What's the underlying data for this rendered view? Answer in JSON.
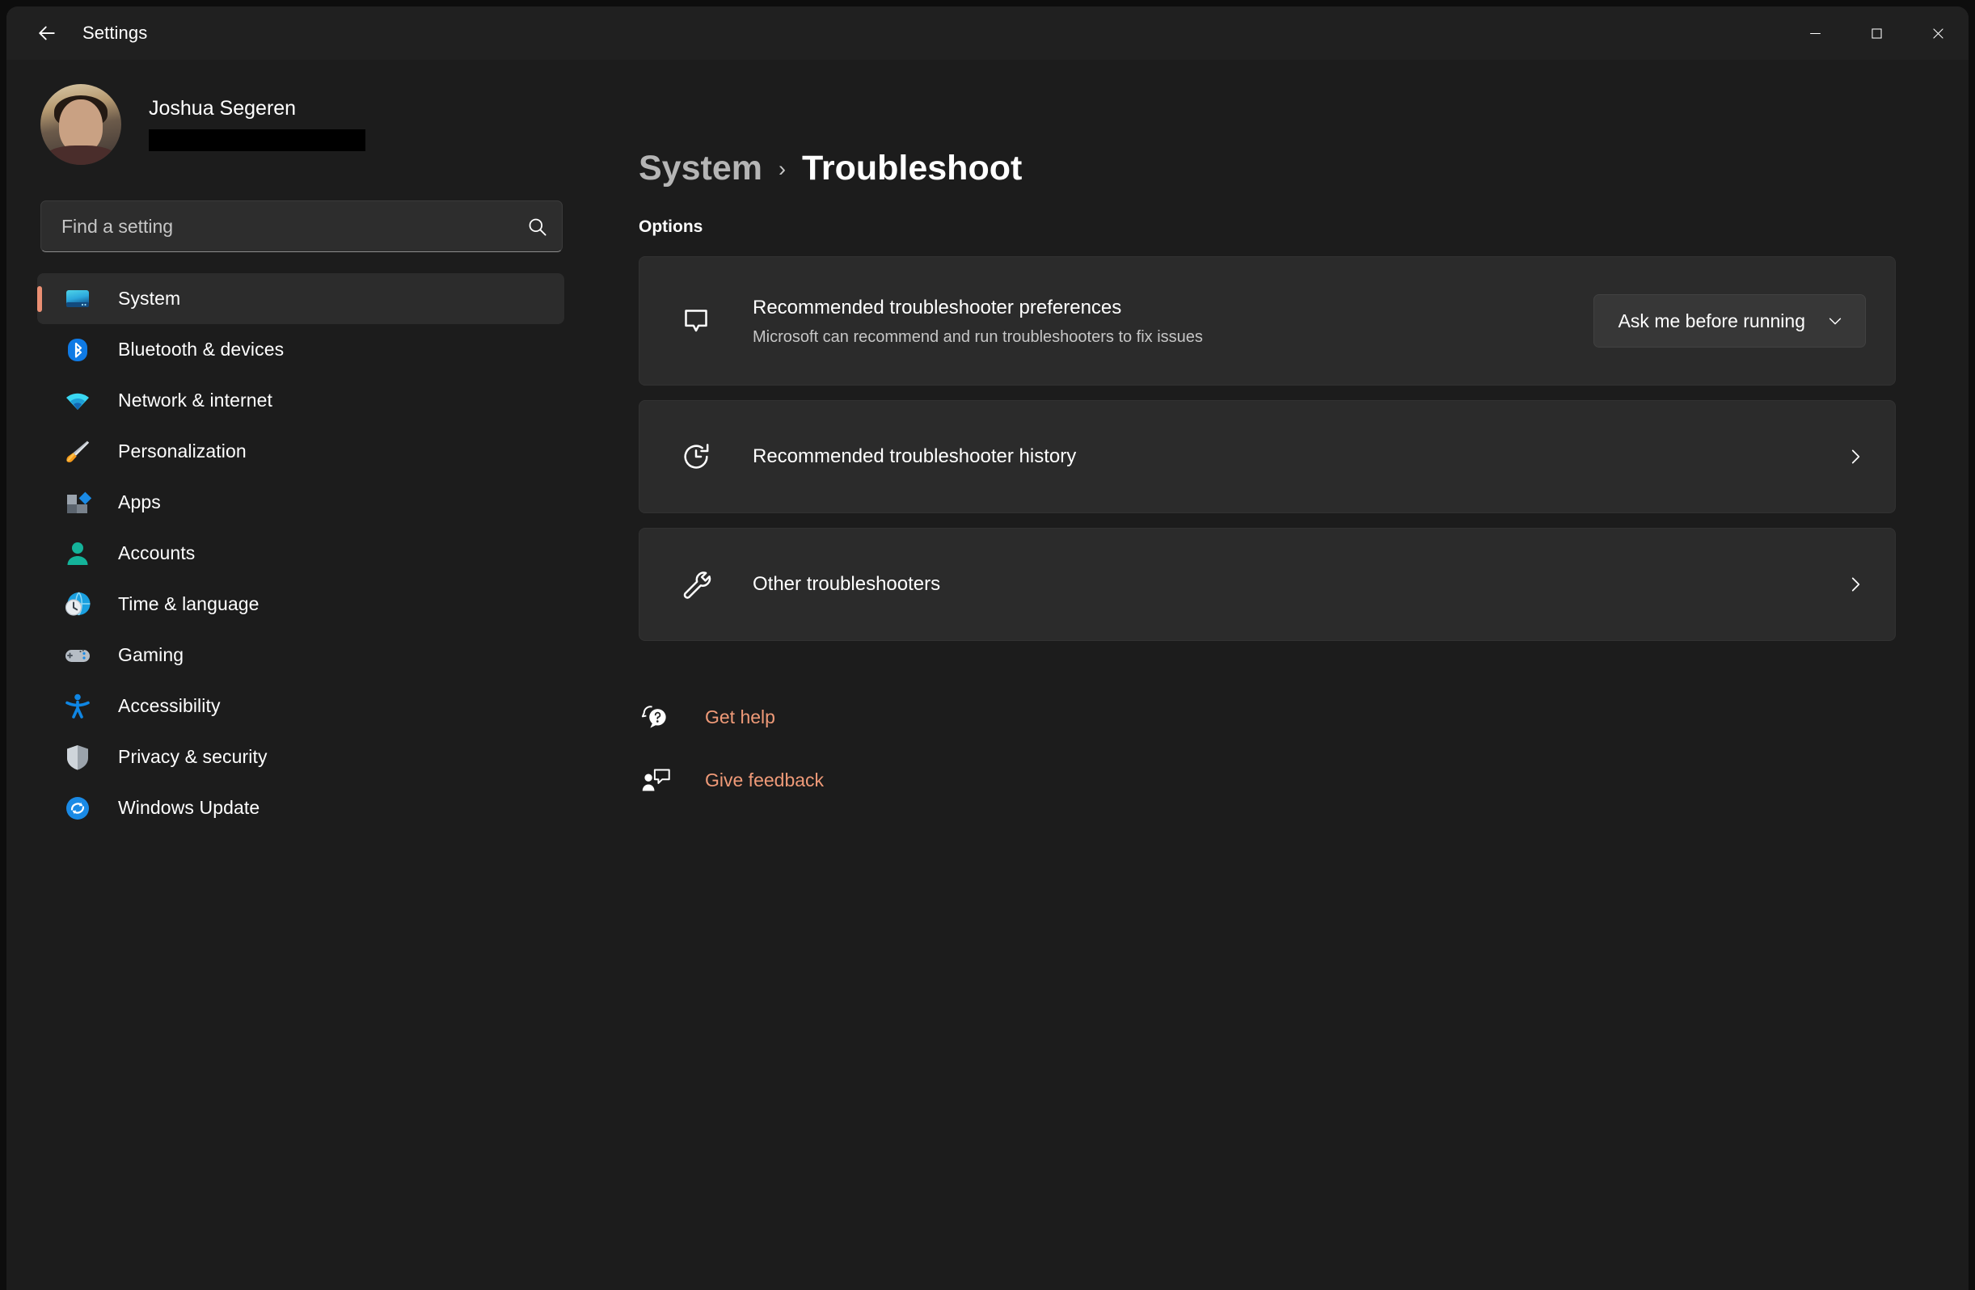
{
  "window": {
    "title": "Settings",
    "back_icon": "back-arrow-icon",
    "controls": {
      "minimize": "minimize-icon",
      "maximize": "maximize-icon",
      "close": "close-icon"
    }
  },
  "colors": {
    "accent": "#ef9a78",
    "selection_bar": "#ea8f73",
    "page_bg": "#1c1c1c",
    "card_bg": "#2b2b2b",
    "titlebar_bg": "#202020"
  },
  "sidebar": {
    "profile": {
      "name": "Joshua Segeren",
      "email_redacted": true
    },
    "search": {
      "placeholder": "Find a setting",
      "value": "",
      "icon": "search-icon"
    },
    "items": [
      {
        "label": "System",
        "icon": "monitor-icon",
        "selected": true
      },
      {
        "label": "Bluetooth & devices",
        "icon": "bluetooth-icon",
        "selected": false
      },
      {
        "label": "Network & internet",
        "icon": "wifi-icon",
        "selected": false
      },
      {
        "label": "Personalization",
        "icon": "paintbrush-icon",
        "selected": false
      },
      {
        "label": "Apps",
        "icon": "apps-blocks-icon",
        "selected": false
      },
      {
        "label": "Accounts",
        "icon": "person-icon",
        "selected": false
      },
      {
        "label": "Time & language",
        "icon": "clock-globe-icon",
        "selected": false
      },
      {
        "label": "Gaming",
        "icon": "gamepad-icon",
        "selected": false
      },
      {
        "label": "Accessibility",
        "icon": "accessibility-person-icon",
        "selected": false
      },
      {
        "label": "Privacy & security",
        "icon": "shield-icon",
        "selected": false
      },
      {
        "label": "Windows Update",
        "icon": "refresh-circle-icon",
        "selected": false
      }
    ]
  },
  "main": {
    "breadcrumb": {
      "parent": "System",
      "separator": "›",
      "current": "Troubleshoot"
    },
    "section_label": "Options",
    "cards": [
      {
        "icon": "speech-bubble-icon",
        "title": "Recommended troubleshooter preferences",
        "subtitle": "Microsoft can recommend and run troubleshooters to fix issues",
        "control": "dropdown",
        "dropdown_value": "Ask me before running",
        "dropdown_icon": "chevron-down-icon"
      },
      {
        "icon": "history-icon",
        "title": "Recommended troubleshooter history",
        "subtitle": "",
        "control": "chevron",
        "chevron_icon": "chevron-right-icon"
      },
      {
        "icon": "wrench-icon",
        "title": "Other troubleshooters",
        "subtitle": "",
        "control": "chevron",
        "chevron_icon": "chevron-right-icon"
      }
    ],
    "footer_links": [
      {
        "label": "Get help",
        "icon": "help-question-bubble-icon"
      },
      {
        "label": "Give feedback",
        "icon": "feedback-person-icon"
      }
    ]
  }
}
